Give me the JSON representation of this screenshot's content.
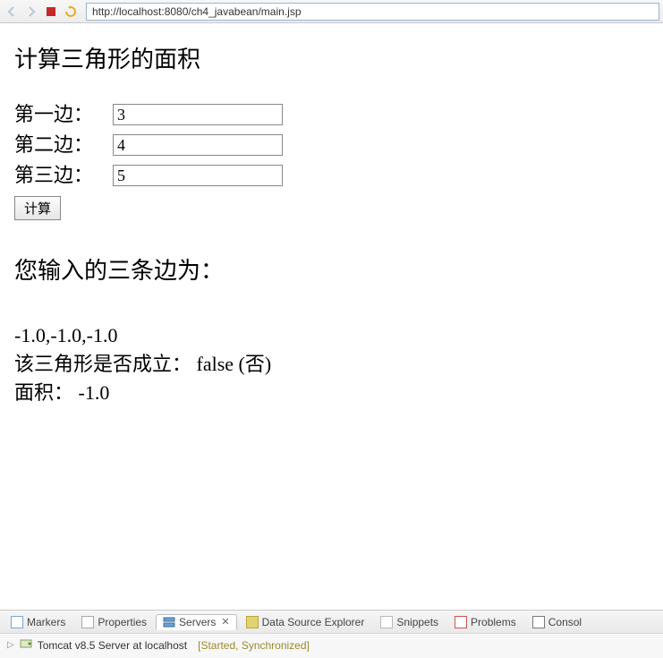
{
  "toolbar": {
    "url": "http://localhost:8080/ch4_javabean/main.jsp"
  },
  "page": {
    "title": "计算三角形的面积",
    "side1_label": "第一边：",
    "side2_label": "第二边：",
    "side3_label": "第三边：",
    "side1_value": "3",
    "side2_value": "4",
    "side3_value": "5",
    "calc_label": "计算",
    "result_header": "您输入的三条边为：",
    "sides_echo": "-1.0,-1.0,-1.0",
    "valid_label": "该三角形是否成立：",
    "valid_value": "false (否)",
    "area_label": "面积：",
    "area_value": "-1.0"
  },
  "tabs": {
    "markers": "Markers",
    "properties": "Properties",
    "servers": "Servers",
    "dse": "Data Source Explorer",
    "snippets": "Snippets",
    "problems": "Problems",
    "console": "Consol"
  },
  "server": {
    "name": "Tomcat v8.5 Server at localhost",
    "status": "[Started, Synchronized]"
  }
}
